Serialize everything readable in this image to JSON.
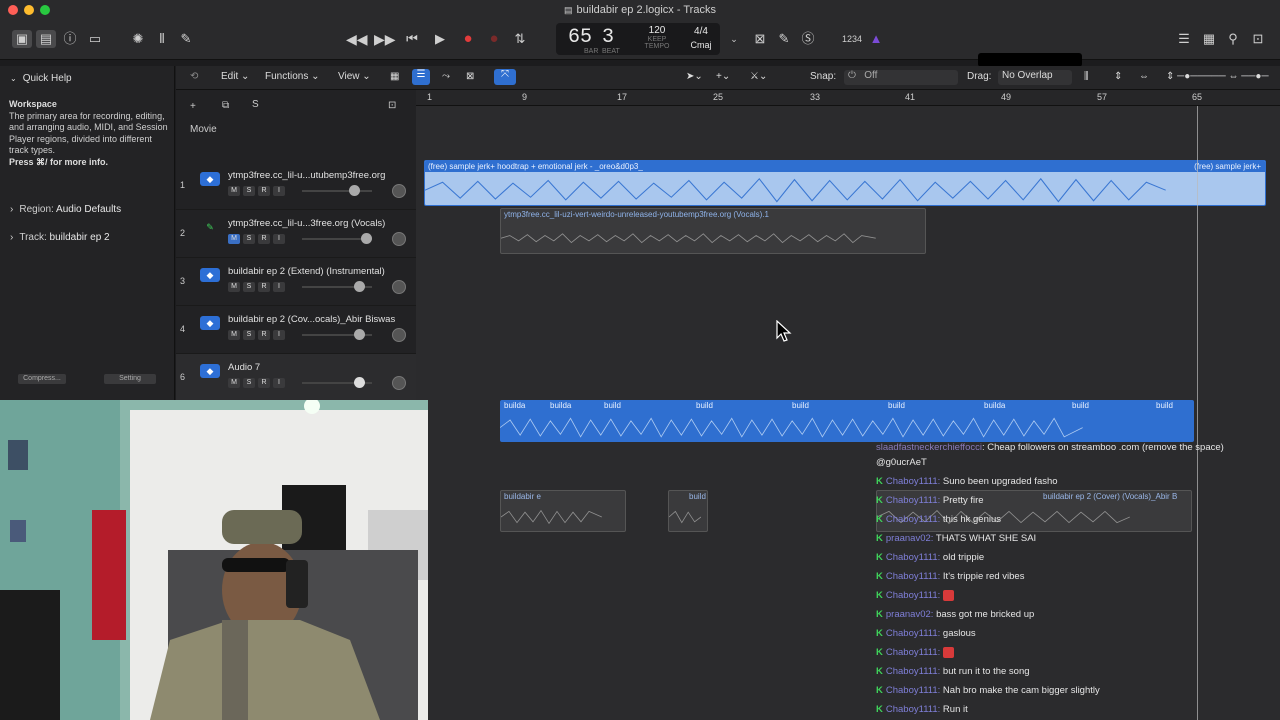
{
  "window": {
    "title": "buildabir ep 2.logicx - Tracks"
  },
  "lcd": {
    "bar": "65",
    "beat": "3",
    "bar_label": "BAR",
    "beat_label": "BEAT",
    "tempo": "120",
    "keep": "KEEP",
    "tempo_label": "TEMPO",
    "signature": "4/4",
    "key": "Cmaj",
    "count": "1234"
  },
  "quick_help": {
    "title": "Quick Help",
    "heading": "Workspace",
    "body": "The primary area for recording, editing, and arranging audio, MIDI, and Session Player regions, divided into different track types.",
    "hint": "Press ⌘/ for more info."
  },
  "inspector": {
    "region_label": "Region:",
    "region_value": "Audio Defaults",
    "track_label": "Track:",
    "track_value": "buildabir ep 2",
    "compress": "Compress...",
    "setting": "Setting"
  },
  "editbar": {
    "edit": "Edit",
    "functions": "Functions",
    "view": "View",
    "snap_label": "Snap:",
    "snap_value": "Off",
    "drag_label": "Drag:",
    "drag_value": "No Overlap",
    "movie": "Movie",
    "s_btn": "S"
  },
  "ruler": {
    "bars": [
      "1",
      "9",
      "17",
      "25",
      "33",
      "41",
      "49",
      "57",
      "65"
    ]
  },
  "tracks": [
    {
      "num": "1",
      "name": "ytmp3free.cc_lil-u...utubemp3free.org"
    },
    {
      "num": "2",
      "name": "ytmp3free.cc_lil-u...3free.org (Vocals)"
    },
    {
      "num": "3",
      "name": "buildabir ep 2 (Extend) (Instrumental)"
    },
    {
      "num": "4",
      "name": "buildabir ep 2 (Cov...ocals)_Abir Biswas"
    },
    {
      "num": "6",
      "name": "Audio 7"
    }
  ],
  "msri": {
    "m": "M",
    "s": "S",
    "r": "R",
    "i": "I"
  },
  "regions": {
    "r1": "(free) sample jerk+ hoodtrap + emotional jerk - _oreo&d0p3_",
    "r1b": "(free) sample jerk+",
    "r2": "ytmp3free.cc_lil-uzi-vert-weirdo-unreleased-youtubemp3free.org (Vocals).1",
    "r3": "builda",
    "r4": "buildabir e",
    "r5": "build",
    "r6": "buildabir ep 2 (Cover) (Vocals)_Abir B"
  },
  "chat": [
    {
      "user": "slaadfastneckerchieffocci",
      "text": "Cheap followers on streamboo .com (remove the space)",
      "badge": false
    },
    {
      "user": "",
      "text": "@g0ucrAeT",
      "badge": false
    },
    {
      "user": "Chaboy1111:",
      "text": "Suno been upgraded fasho",
      "badge": true
    },
    {
      "user": "Chaboy1111:",
      "text": "Pretty fire",
      "badge": true
    },
    {
      "user": "Chaboy1111:",
      "text": "this hk genius",
      "badge": true
    },
    {
      "user": "praanav02:",
      "text": "THATS WHAT SHE SAI",
      "badge": true
    },
    {
      "user": "Chaboy1111:",
      "text": "old trippie",
      "badge": true
    },
    {
      "user": "Chaboy1111:",
      "text": "It's trippie red vibes",
      "badge": true
    },
    {
      "user": "Chaboy1111:",
      "text": "",
      "badge": true,
      "emote": true
    },
    {
      "user": "praanav02:",
      "text": "bass got me bricked up",
      "badge": true
    },
    {
      "user": "Chaboy1111:",
      "text": "gaslous",
      "badge": true
    },
    {
      "user": "Chaboy1111:",
      "text": "",
      "badge": true,
      "emote": true
    },
    {
      "user": "Chaboy1111:",
      "text": "but run it to the song",
      "badge": true
    },
    {
      "user": "Chaboy1111:",
      "text": "Nah bro make the cam bigger slightly",
      "badge": true
    },
    {
      "user": "Chaboy1111:",
      "text": "Run it",
      "badge": true
    }
  ],
  "colors": {
    "region_blue": "#2f6fd0",
    "region_light": "#a9c7ee",
    "chat_user": "#7f7fd8",
    "chat_badge": "#3fd15a"
  }
}
